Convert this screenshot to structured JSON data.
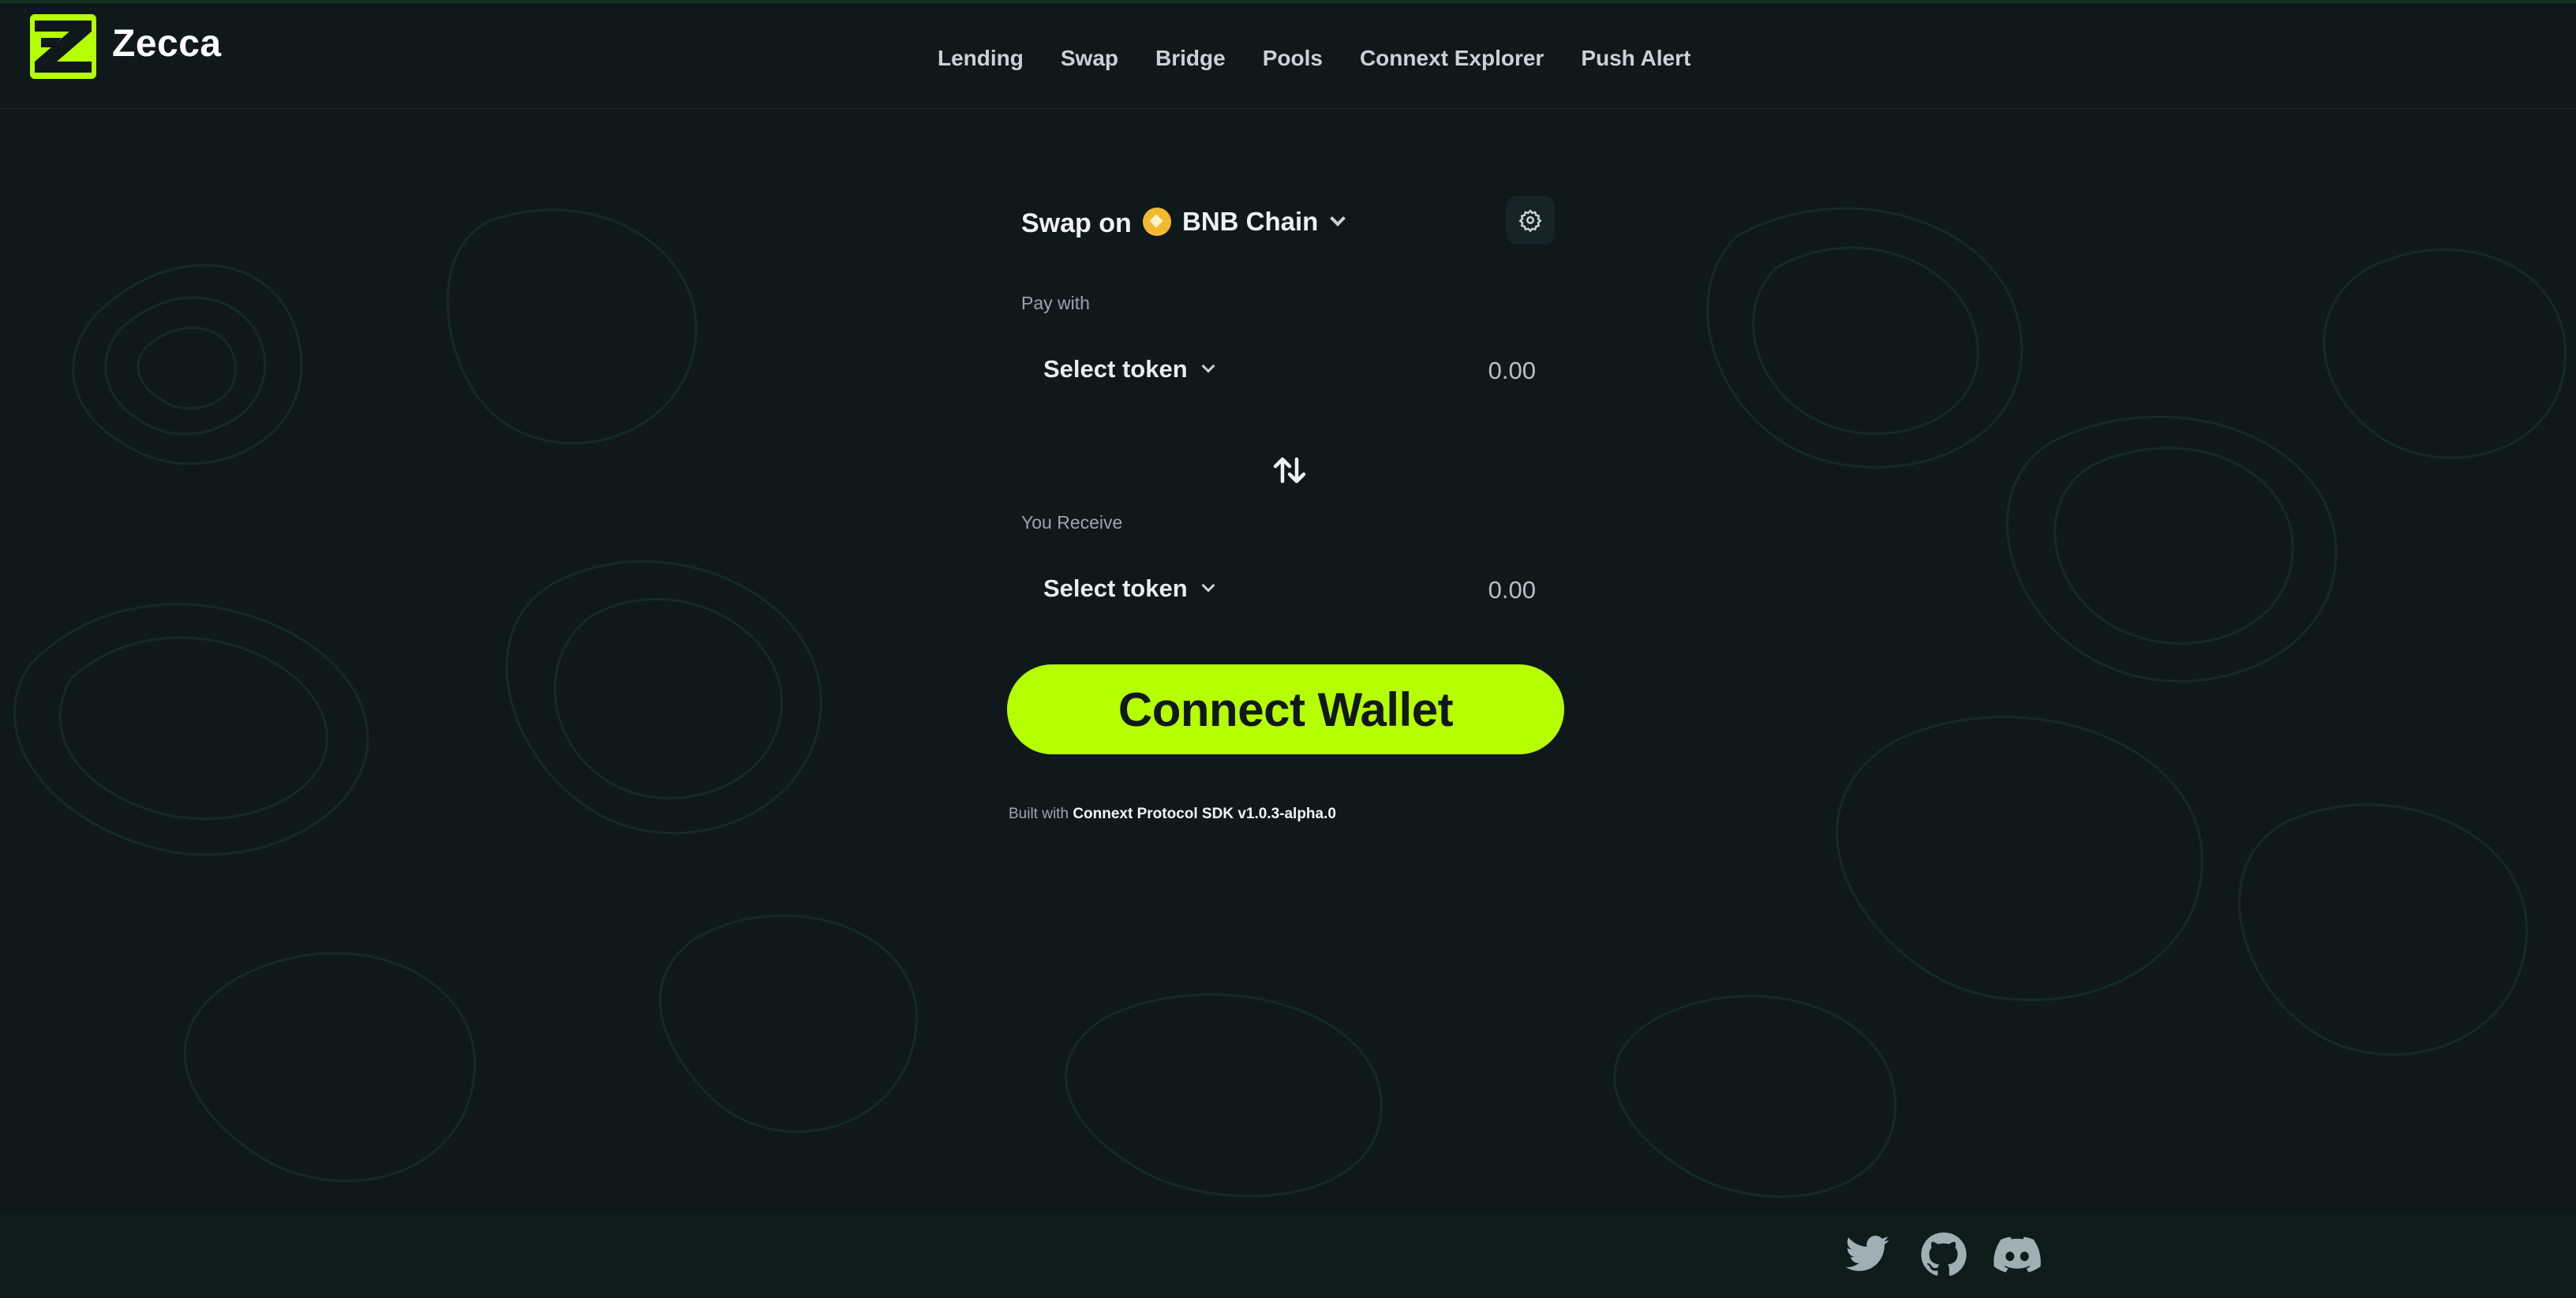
{
  "app": {
    "brand": "Zecca"
  },
  "nav": [
    {
      "label": "Lending"
    },
    {
      "label": "Swap"
    },
    {
      "label": "Bridge"
    },
    {
      "label": "Pools"
    },
    {
      "label": "Connext Explorer"
    },
    {
      "label": "Push Alert"
    }
  ],
  "swap": {
    "title": "Swap on",
    "chain": "BNB Chain",
    "pay_label": "Pay with",
    "receive_label": "You Receive",
    "pay_token": "Select token",
    "pay_amount": "0.00",
    "receive_token": "Select token",
    "receive_amount": "0.00",
    "connect_label": "Connect Wallet"
  },
  "footer_note": {
    "prefix": "Built with",
    "sdk": "Connext Protocol SDK v1.0.3-alpha.0"
  },
  "social": [
    "twitter-icon",
    "github-icon",
    "discord-icon"
  ],
  "colors": {
    "accent": "#b6ff00",
    "background": "#0f191c",
    "bnb": "#f3ba2f"
  }
}
